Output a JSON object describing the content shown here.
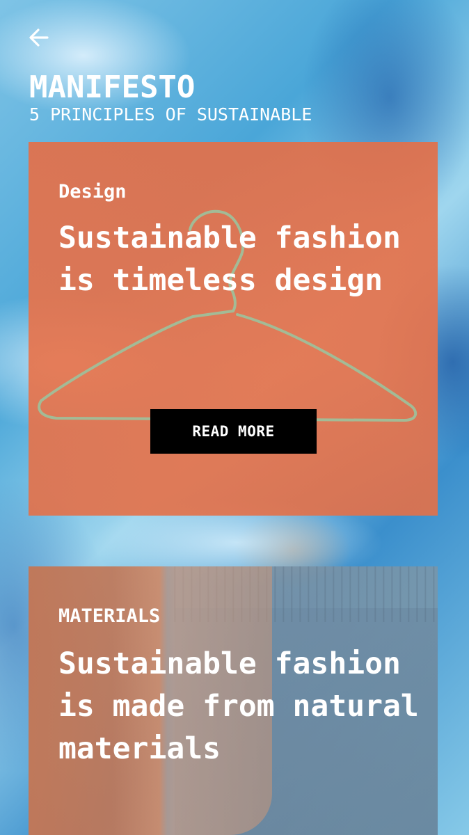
{
  "header": {
    "back_icon": "arrow-left-icon",
    "title": "MANIFESTO",
    "subtitle": "5 PRINCIPLES OF SUSTAINABLE"
  },
  "cards": [
    {
      "category": "Design",
      "headline": "Sustainable fashion is timeless design",
      "button_label": "READ MORE",
      "image": "wire-hanger",
      "tint_color": "#e2704a"
    },
    {
      "category": "MATERIALS",
      "headline": "Sustainable fashion is made from natural materials",
      "image": "person-in-grey-trousers",
      "tint_color": "#c47654"
    }
  ],
  "colors": {
    "background": "#4aa6d8",
    "text": "#ffffff",
    "button_background": "#000000"
  }
}
